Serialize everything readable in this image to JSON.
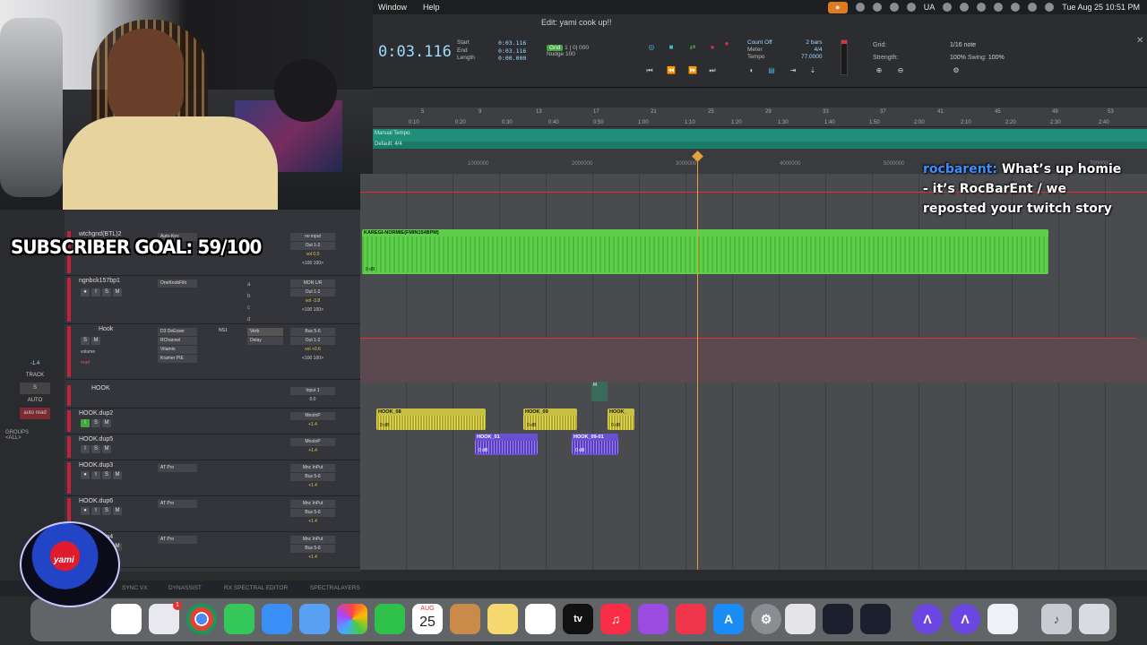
{
  "menubar": {
    "items": [
      "Window",
      "Help"
    ],
    "right": {
      "lang": "UA",
      "datetime": "Tue Aug 25  10:51 PM"
    }
  },
  "window_title": "Edit: yami cook up!!",
  "transport": {
    "main_counter": "0:03.116",
    "sel_labels": [
      "Start",
      "End",
      "Length"
    ],
    "sel_values": [
      "0:03.116",
      "0:03.116",
      "0:00.000"
    ],
    "grid_badge": "Grid",
    "grid_value": "1 | 0| 000",
    "nudge_label": "Nudge",
    "nudge_value": "100",
    "count_off": "Count Off",
    "meter_label": "Meter",
    "tempo_label": "Tempo",
    "bars": "2 bars",
    "meter_value": "4/4",
    "tempo_value": "77.0000",
    "grid_setting_label": "Grid:",
    "grid_note": "1/16 note",
    "strength_label": "Strength:",
    "strength_value": "100%",
    "swing_label": "Swing:",
    "swing_value": "100%"
  },
  "rulers": {
    "minsec_ticks": [
      "0:10",
      "0:20",
      "0:30",
      "0:40",
      "0:50",
      "1:00",
      "1:10",
      "1:20",
      "1:30",
      "1:40",
      "1:50",
      "2:00",
      "2:10",
      "2:20",
      "2:30",
      "2:40"
    ],
    "bar_ticks": [
      "5",
      "9",
      "13",
      "17",
      "21",
      "25",
      "29",
      "33",
      "37",
      "41",
      "45",
      "49",
      "53"
    ],
    "tempo_label": "Manual Tempo: ",
    "meter_label": "Default: 4/4",
    "samples_ticks": [
      "1000000",
      "2000000",
      "3000000",
      "4000000",
      "5000000",
      "7000000"
    ]
  },
  "chat": {
    "user": "rocbarent:",
    "message": "What’s up homie - it’s RocBarEnt / we reposted your twitch story"
  },
  "overlay": {
    "subscriber_goal": "SUBSCRIBER GOAL: 59/100",
    "logo_text": "yami"
  },
  "left_panel": {
    "value": "-1.4",
    "track_label": "TRACK",
    "s": "S",
    "auto_label": "AUTO",
    "auto_mode": "auto read",
    "groups_label": "GROUPS",
    "groups_all": "<ALL>"
  },
  "tracks": [
    {
      "name": "wtchgnd(BTL)2",
      "inserts": [
        "Auto-Key"
      ],
      "io": [
        "no input",
        "Out 1-2"
      ],
      "vol": "vol  0.0",
      "pan": "<100  100>"
    },
    {
      "name": "ngnbck157bp1",
      "inserts": [
        "OneKnobFiltr"
      ],
      "io": [
        "MON L/R",
        "Out 1-2"
      ],
      "vol": "vol  -3.8",
      "pan": "<100  100>"
    },
    {
      "name": "Hook",
      "inserts": [
        "D3 DeEsser",
        "RChannel",
        "Vitamin",
        "Kramer PIE"
      ],
      "sends": [
        "Verb",
        "Delay"
      ],
      "io": [
        "Bus 5-6",
        "Out 1-2"
      ],
      "vol": "vol  +0.6",
      "pan": "<100  100>",
      "auto": "volume",
      "mode": "read",
      "ns": "NS1"
    },
    {
      "name": "HOOK",
      "io": [
        "Input 1",
        "Bs5-6"
      ],
      "vol": "0.0"
    },
    {
      "name": "HOOK.dup2",
      "io": [
        "MnoInP",
        "Bs5-6"
      ],
      "vol": "+1.4"
    },
    {
      "name": "HOOK.dup5",
      "io": [
        "MnoInP",
        "Bs5-6"
      ],
      "vol": "+1.4"
    },
    {
      "name": "HOOK.dup3",
      "inserts": [
        "AT Pro"
      ],
      "io": [
        "Mnc InPut",
        "Bus 5-6"
      ],
      "vol": "+1.4"
    },
    {
      "name": "HOOK.dup6",
      "inserts": [
        "AT Pro"
      ],
      "io": [
        "Mnc InPut",
        "Bus 5-6"
      ],
      "vol": "+1.4"
    },
    {
      "name": "HOOK.dup4",
      "inserts": [
        "AT Pro"
      ],
      "io": [
        "Mnc InPut",
        "Bus 5-6"
      ],
      "vol": "+1.4"
    }
  ],
  "clips": {
    "beat": {
      "name": "KAREGI-NORMIE(FMIN154BPM)",
      "db": "0 dB"
    },
    "hook_small": "H",
    "hook1": {
      "name": "HOOK_08",
      "db": "0 dB"
    },
    "hook2": {
      "name": "HOOK_09",
      "db": "0 dB"
    },
    "hook3": {
      "name": "HOOK_",
      "db": "0 dB"
    },
    "hook4": {
      "name": "HOOK_01",
      "db": "0 dB"
    },
    "hook5": {
      "name": "HOOK_09-01",
      "db": "0 dB"
    }
  },
  "plugin_bar": [
    "SYNC VX",
    "DYNASSIST",
    "RX SPECTRAL EDITOR",
    "SPECTRALAYERS"
  ],
  "dock": {
    "calendar_month": "AUG",
    "calendar_day": "25",
    "badges": [
      "1"
    ],
    "tv_label": "tv"
  }
}
